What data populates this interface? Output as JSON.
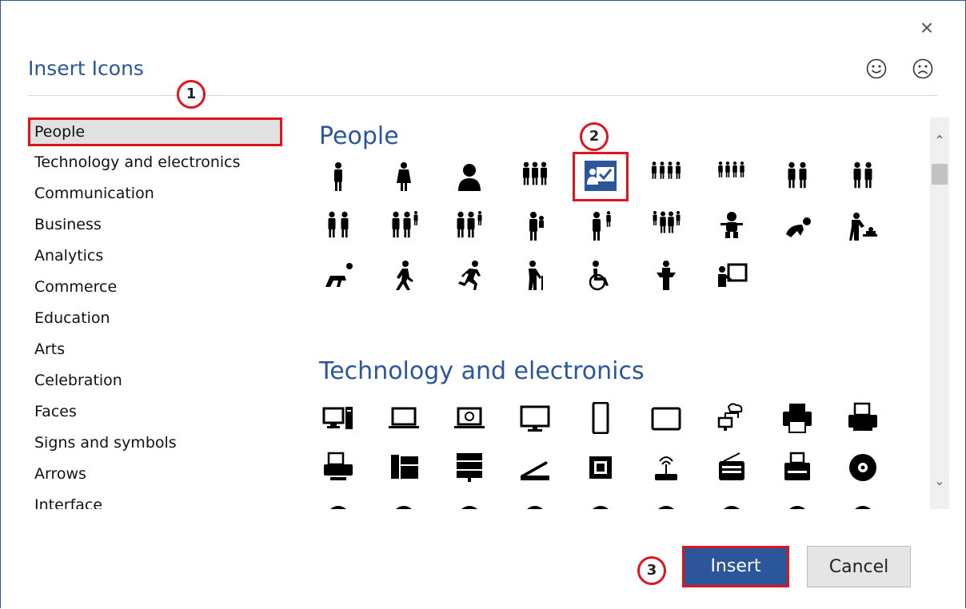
{
  "dialog": {
    "title": "Insert Icons",
    "close_icon": "close-icon",
    "feedback": {
      "smile_icon": "smile-icon",
      "frown_icon": "frown-icon"
    }
  },
  "callouts": [
    "1",
    "2",
    "3"
  ],
  "categories": [
    {
      "label": "People",
      "selected": true
    },
    {
      "label": "Technology and electronics"
    },
    {
      "label": "Communication"
    },
    {
      "label": "Business"
    },
    {
      "label": "Analytics"
    },
    {
      "label": "Commerce"
    },
    {
      "label": "Education"
    },
    {
      "label": "Arts"
    },
    {
      "label": "Celebration"
    },
    {
      "label": "Faces"
    },
    {
      "label": "Signs and symbols"
    },
    {
      "label": "Arrows"
    },
    {
      "label": "Interface"
    }
  ],
  "sections": [
    {
      "heading": "People",
      "icons": [
        "man-icon",
        "woman-icon",
        "user-icon",
        "group-icon",
        "presenter-checkmark-icon",
        "crowd-icon",
        "crowd-small-icon",
        "couple-icon",
        "couple-women-icon",
        "family-icon",
        "family-child-icon",
        "family-two-children-icon",
        "parent-carrying-child-icon",
        "parent-with-child-icon",
        "family-crowd-icon",
        "baby-icon",
        "crawling-baby-icon",
        "diaper-changing-icon",
        "start-position-icon",
        "walking-icon",
        "running-icon",
        "elderly-cane-icon",
        "wheelchair-icon",
        "speaker-podium-icon",
        "presentation-board-icon"
      ]
    },
    {
      "heading": "Technology and electronics",
      "icons": [
        "desktop-computer-icon",
        "laptop-icon",
        "laptop-globe-icon",
        "monitor-icon",
        "smartphone-icon",
        "tablet-icon",
        "network-cloud-icon",
        "printer-icon",
        "printer-document-icon",
        "fax-machine-icon",
        "copier-icon",
        "server-icon",
        "scanner-icon",
        "processor-chip-icon",
        "wifi-router-icon",
        "radio-icon",
        "typewriter-icon",
        "disc-icon",
        "icon-28",
        "icon-29",
        "icon-30",
        "icon-31",
        "icon-32",
        "icon-33",
        "icon-34",
        "icon-35",
        "icon-36"
      ]
    }
  ],
  "buttons": {
    "insert": "Insert",
    "cancel": "Cancel"
  },
  "colors": {
    "accent": "#2b579a",
    "callout": "#e0141e"
  }
}
